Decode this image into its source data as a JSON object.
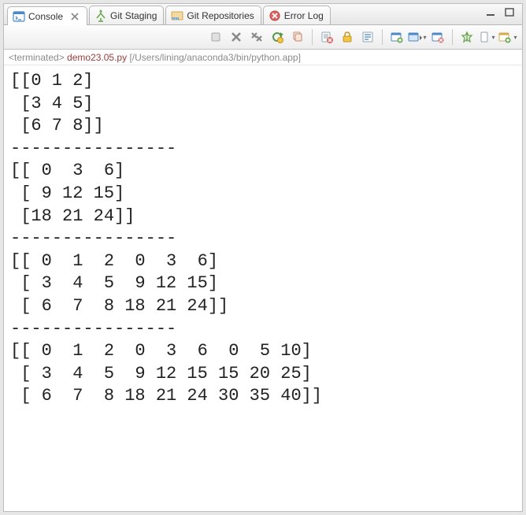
{
  "tabs": [
    {
      "label": "Console",
      "active": true
    },
    {
      "label": "Git Staging",
      "active": false
    },
    {
      "label": "Git Repositories",
      "active": false
    },
    {
      "label": "Error Log",
      "active": false
    }
  ],
  "status": {
    "prefix": "<terminated> ",
    "title": "demo23.05.py",
    "path": " [/Users/lining/anaconda3/bin/python.app]"
  },
  "console_output": "[[0 1 2]\n [3 4 5]\n [6 7 8]]\n----------------\n[[ 0  3  6]\n [ 9 12 15]\n [18 21 24]]\n----------------\n[[ 0  1  2  0  3  6]\n [ 3  4  5  9 12 15]\n [ 6  7  8 18 21 24]]\n----------------\n[[ 0  1  2  0  3  6  0  5 10]\n [ 3  4  5  9 12 15 15 20 25]\n [ 6  7  8 18 21 24 30 35 40]]"
}
